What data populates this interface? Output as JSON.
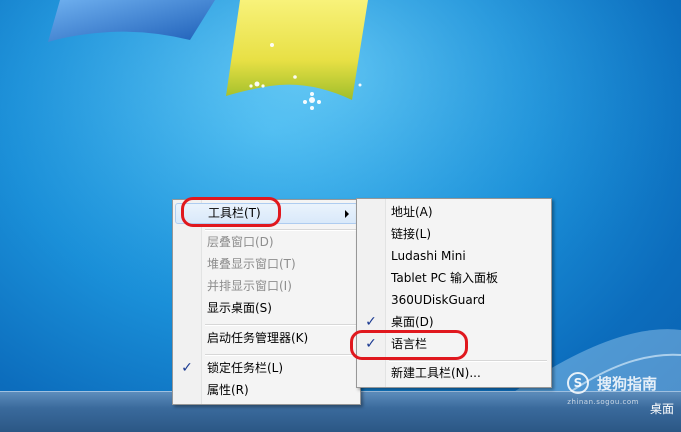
{
  "context_menu": {
    "items": [
      {
        "label": "工具栏(T)"
      },
      {
        "label": "层叠窗口(D)"
      },
      {
        "label": "堆叠显示窗口(T)"
      },
      {
        "label": "并排显示窗口(I)"
      },
      {
        "label": "显示桌面(S)"
      },
      {
        "label": "启动任务管理器(K)"
      },
      {
        "label": "锁定任务栏(L)"
      },
      {
        "label": "属性(R)"
      }
    ]
  },
  "toolbar_submenu": {
    "items": [
      {
        "label": "地址(A)"
      },
      {
        "label": "链接(L)"
      },
      {
        "label": "Ludashi Mini"
      },
      {
        "label": "Tablet PC 输入面板"
      },
      {
        "label": "360UDiskGuard"
      },
      {
        "label": "桌面(D)"
      },
      {
        "label": "语言栏"
      },
      {
        "label": "新建工具栏(N)..."
      }
    ]
  },
  "check_glyph": "✓",
  "taskbar": {
    "desktop_label": "桌面"
  },
  "watermark": {
    "logo": "S",
    "text": "搜狗指南",
    "subtext": "zhinan.sogou.com"
  },
  "colors": {
    "highlight_ring": "#e0181e",
    "check": "#1b3a92"
  }
}
